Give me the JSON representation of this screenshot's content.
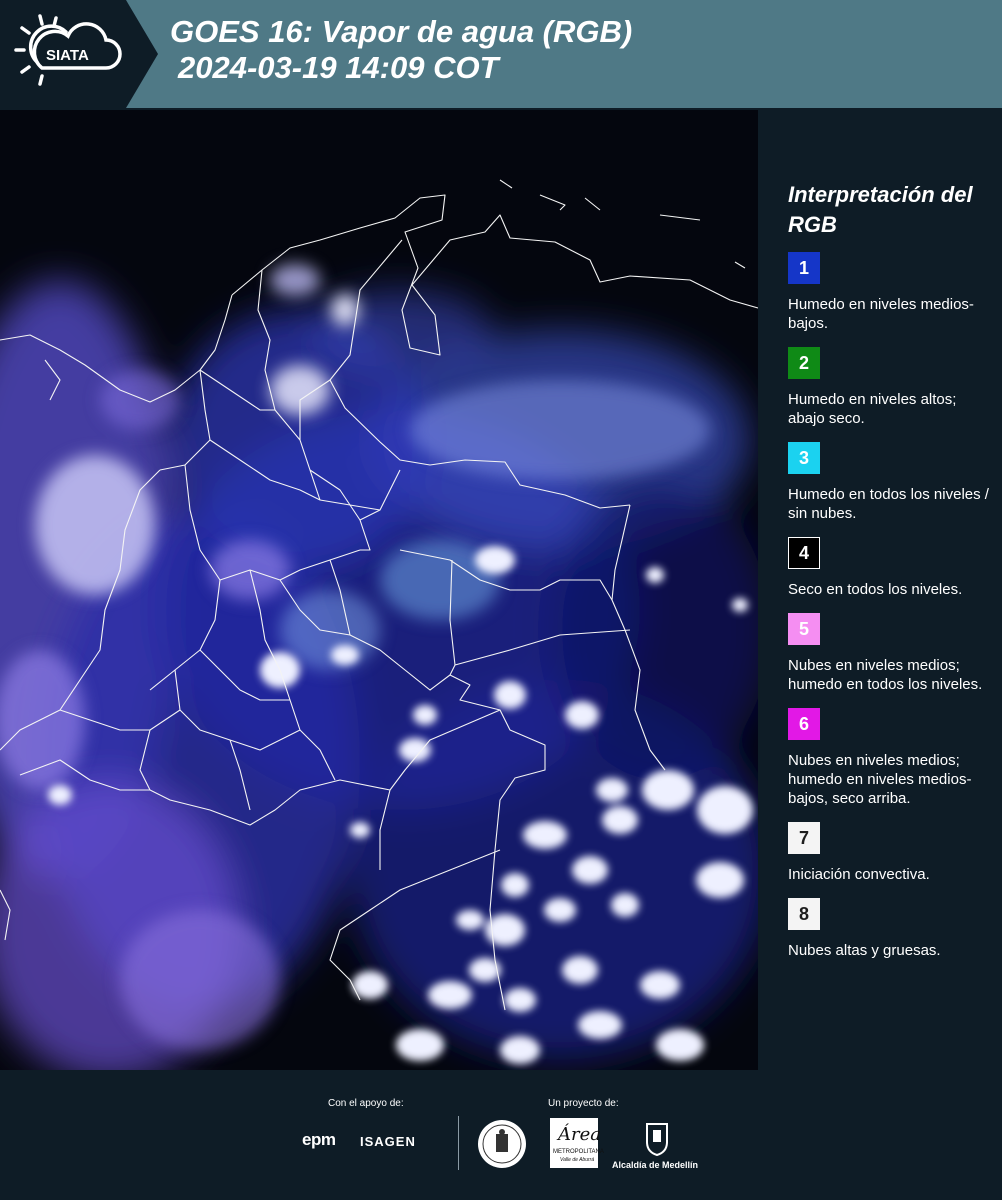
{
  "header": {
    "logo_text": "SIATA",
    "title_line1": "GOES 16: Vapor de agua (RGB)",
    "title_line2": "2024-03-19 14:09 COT",
    "background_color": "#4f7986"
  },
  "legend": {
    "title": "Interpretación del RGB",
    "items": [
      {
        "number": "1",
        "color": "#1536c8",
        "text": "Humedo en niveles medios-bajos."
      },
      {
        "number": "2",
        "color": "#0f8a16",
        "text": "Humedo en niveles altos; abajo seco."
      },
      {
        "number": "3",
        "color": "#1bd2f0",
        "text": "Humedo en todos los niveles / sin nubes."
      },
      {
        "number": "4",
        "color": "#000000",
        "text": "Seco en todos los niveles."
      },
      {
        "number": "5",
        "color": "#f58ef2",
        "text": "Nubes en niveles medios; humedo en todos los niveles."
      },
      {
        "number": "6",
        "color": "#e218e6",
        "text": "Nubes en niveles medios; humedo en niveles medios-bajos, seco arriba."
      },
      {
        "number": "7",
        "color": "#f4f4f4",
        "text": "Iniciación convectiva."
      },
      {
        "number": "8",
        "color": "#f4f4f4",
        "text": "Nubes altas y gruesas."
      }
    ]
  },
  "footer": {
    "support_label": "Con el apoyo de:",
    "project_label": "Un proyecto de:",
    "sponsor1": "epm",
    "sponsor2": "ISAGEN",
    "area_logo_name": "Área",
    "area_logo_sub1": "METROPOLITANA",
    "area_logo_sub2": "Valle de Aburrá",
    "alcaldia": "Alcaldía de Medellín"
  }
}
